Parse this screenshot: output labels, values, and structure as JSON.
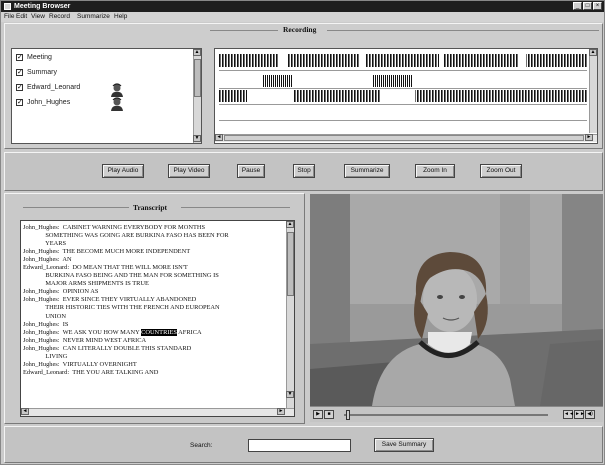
{
  "window": {
    "title": "Meeting Browser"
  },
  "menu": [
    "File",
    "Edit",
    "View",
    "Record",
    "Summarize",
    "Help"
  ],
  "recording": {
    "heading": "Recording",
    "tracks": [
      {
        "label": "Meeting",
        "checked": true
      },
      {
        "label": "Summary",
        "checked": true
      },
      {
        "label": "Edward_Leonard",
        "checked": true,
        "has_icon": true
      },
      {
        "label": "John_Hughes",
        "checked": true,
        "has_icon": true
      }
    ]
  },
  "controls": {
    "play_audio": "Play Audio",
    "play_video": "Play Video",
    "pause": "Pause",
    "stop": "Stop",
    "summarize": "Summarize",
    "zoom_in": "Zoom In",
    "zoom_out": "Zoom Out"
  },
  "transcript": {
    "heading": "Transcript",
    "lines": [
      [
        "John_Hughes:  CABINET WARNING EVERYBODY FOR MONTHS",
        ""
      ],
      [
        "              SOMETHING WAS GOING ARE BURKINA FASO HAS BEEN FOR",
        ""
      ],
      [
        "              YEARS",
        ""
      ],
      [
        "John_Hughes:  THE BECOME MUCH MORE INDEPENDENT",
        ""
      ],
      [
        "John_Hughes:  AN",
        ""
      ],
      [
        "Edward_Leonard:  DO MEAN THAT THE WILL MORE ISN'T",
        ""
      ],
      [
        "              BURKINA FASO BEING AND THE MAN FOR SOMETHING IS",
        ""
      ],
      [
        "              MAJOR ARMS SHIPMENTS IS TRUE",
        ""
      ],
      [
        "John_Hughes:  OPINION AS",
        ""
      ],
      [
        "John_Hughes:  EVER SINCE THEY VIRTUALLY ABANDONED",
        ""
      ],
      [
        "              THEIR HISTORIC TIES WITH THE FRENCH AND EUROPEAN",
        ""
      ],
      [
        "              UNION",
        ""
      ],
      [
        "John_Hughes:  IS",
        ""
      ],
      [
        "John_Hughes:  WE ASK YOU HOW MANY ",
        "COUNTRIES",
        " AFRICA"
      ],
      [
        "John_Hughes:  NEVER MIND WEST AFRICA",
        ""
      ],
      [
        "John_Hughes:  CAN LITERALLY DOUBLE THIS STANDARD",
        ""
      ],
      [
        "              LIVING",
        ""
      ],
      [
        "John_Hughes:  VIRTUALLY OVERNIGHT",
        ""
      ],
      [
        "Edward_Leonard:  THE YOU ARE TALKING AND",
        ""
      ]
    ]
  },
  "search": {
    "label": "Search:",
    "value": "",
    "save_summary": "Save Summary"
  },
  "icons": {
    "minimize": "minimize-icon",
    "maximize": "maximize-icon",
    "close": "close-icon",
    "play": "play-icon",
    "rewind": "rewind-icon",
    "forward": "forward-icon",
    "volume": "volume-icon"
  }
}
